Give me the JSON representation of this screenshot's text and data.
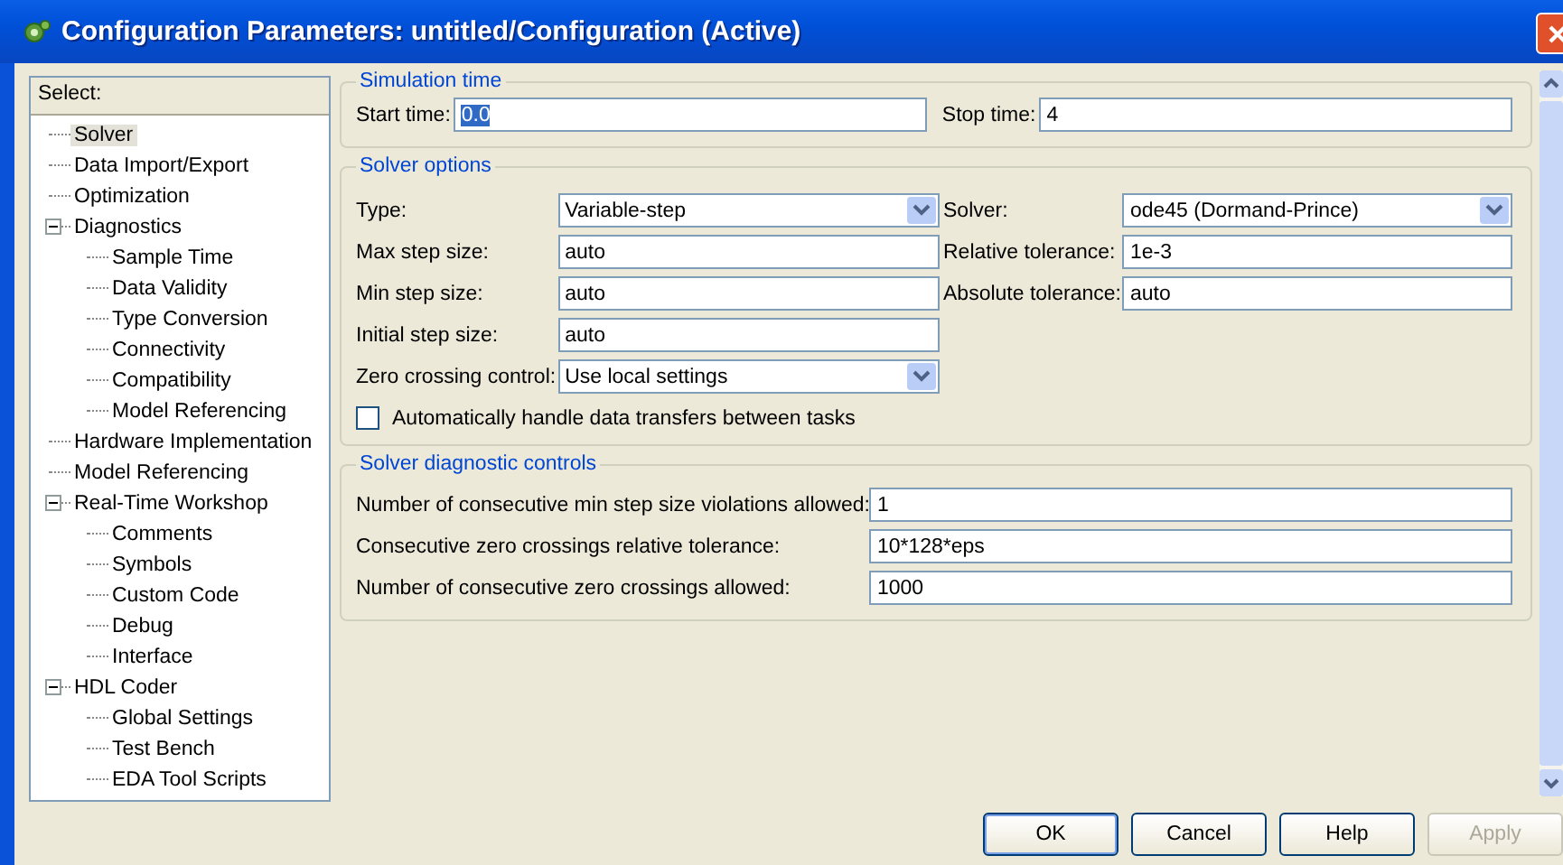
{
  "window": {
    "title": "Configuration Parameters: untitled/Configuration (Active)"
  },
  "tree": {
    "header": "Select:",
    "items": [
      {
        "label": "Solver",
        "selected": true
      },
      {
        "label": "Data Import/Export",
        "selected": false
      },
      {
        "label": "Optimization",
        "selected": false
      },
      {
        "label": "Diagnostics",
        "selected": false,
        "expanded": true,
        "children": [
          {
            "label": "Sample Time",
            "selected": false
          },
          {
            "label": "Data Validity",
            "selected": false
          },
          {
            "label": "Type Conversion",
            "selected": false
          },
          {
            "label": "Connectivity",
            "selected": false
          },
          {
            "label": "Compatibility",
            "selected": false
          },
          {
            "label": "Model Referencing",
            "selected": false
          }
        ]
      },
      {
        "label": "Hardware Implementation",
        "selected": false
      },
      {
        "label": "Model Referencing",
        "selected": false
      },
      {
        "label": "Real-Time Workshop",
        "selected": false,
        "expanded": true,
        "children": [
          {
            "label": "Comments",
            "selected": false
          },
          {
            "label": "Symbols",
            "selected": false
          },
          {
            "label": "Custom Code",
            "selected": false
          },
          {
            "label": "Debug",
            "selected": false
          },
          {
            "label": "Interface",
            "selected": false
          }
        ]
      },
      {
        "label": "HDL Coder",
        "selected": false,
        "expanded": true,
        "children": [
          {
            "label": "Global Settings",
            "selected": false
          },
          {
            "label": "Test Bench",
            "selected": false
          },
          {
            "label": "EDA Tool Scripts",
            "selected": false
          }
        ]
      }
    ]
  },
  "simulation_time": {
    "title": "Simulation time",
    "fields": [
      {
        "label": "Start time:",
        "value": "0.0",
        "text_selected": true
      },
      {
        "label": "Stop time:",
        "value": "4",
        "text_selected": false
      }
    ]
  },
  "solver_options": {
    "title": "Solver options",
    "left_fields": [
      {
        "kind": "dropdown",
        "label": "Type:",
        "value": "Variable-step"
      },
      {
        "kind": "text",
        "label": "Max step size:",
        "value": "auto"
      },
      {
        "kind": "text",
        "label": "Min step size:",
        "value": "auto"
      },
      {
        "kind": "text",
        "label": "Initial step size:",
        "value": "auto"
      },
      {
        "kind": "dropdown",
        "label": "Zero crossing control:",
        "value": "Use local settings"
      }
    ],
    "right_fields": [
      {
        "kind": "dropdown",
        "label": "Solver:",
        "value": "ode45 (Dormand-Prince)"
      },
      {
        "kind": "text",
        "label": "Relative tolerance:",
        "value": "1e-3"
      },
      {
        "kind": "text",
        "label": "Absolute tolerance:",
        "value": "auto"
      }
    ],
    "checkbox": {
      "label": "Automatically handle data transfers between tasks",
      "checked": false
    }
  },
  "diagnostic_controls": {
    "title": "Solver diagnostic controls",
    "fields": [
      {
        "label": "Number of consecutive min step size violations allowed:",
        "value": "1"
      },
      {
        "label": "Consecutive zero crossings relative tolerance:",
        "value": "10*128*eps"
      },
      {
        "label": "Number of consecutive zero crossings allowed:",
        "value": "1000"
      }
    ]
  },
  "buttons": [
    {
      "label": "OK",
      "default": true,
      "disabled": false
    },
    {
      "label": "Cancel",
      "default": false,
      "disabled": false
    },
    {
      "label": "Help",
      "default": false,
      "disabled": false
    },
    {
      "label": "Apply",
      "default": false,
      "disabled": true
    }
  ]
}
